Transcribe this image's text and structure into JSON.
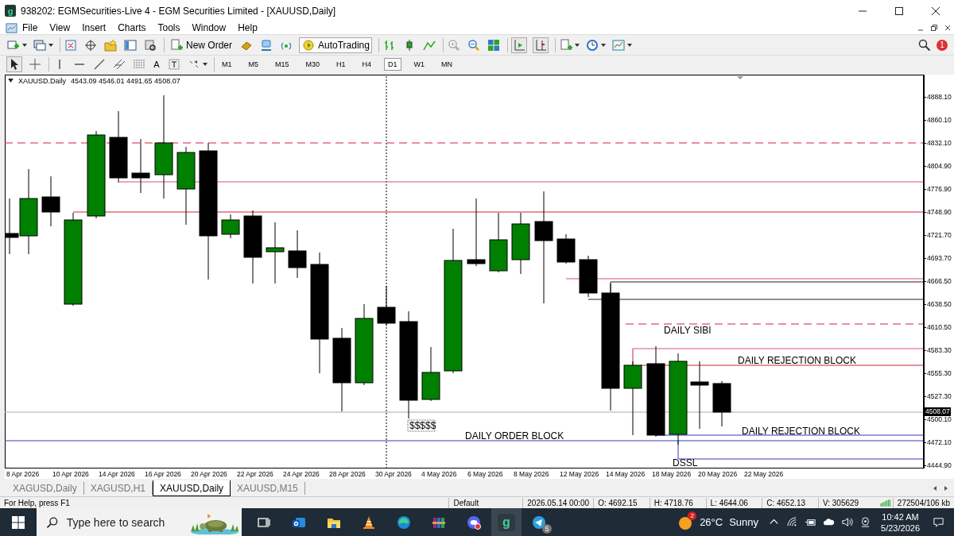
{
  "window": {
    "title": "938202: EGMSecurities-Live 4 - EGM Securities Limited - [XAUUSD,Daily]",
    "icon_letter": "g"
  },
  "menu": [
    "File",
    "View",
    "Insert",
    "Charts",
    "Tools",
    "Window",
    "Help"
  ],
  "toolbar": {
    "new_order": "New Order",
    "autotrading": "AutoTrading",
    "notification_count": "1"
  },
  "drawing_tools": {
    "text_tool": "A"
  },
  "timeframes": [
    {
      "label": "M1",
      "selected": false
    },
    {
      "label": "M5",
      "selected": false
    },
    {
      "label": "M15",
      "selected": false
    },
    {
      "label": "M30",
      "selected": false
    },
    {
      "label": "H1",
      "selected": false
    },
    {
      "label": "H4",
      "selected": false
    },
    {
      "label": "D1",
      "selected": true
    },
    {
      "label": "W1",
      "selected": false
    },
    {
      "label": "MN",
      "selected": false
    }
  ],
  "chart": {
    "symbol": "XAUUSD.Daily",
    "ohlc": "4543.09 4546.01 4491.65 4508.07",
    "price_axis": [
      "4888.10",
      "4860.10",
      "4832.10",
      "4804.90",
      "4776.90",
      "4748.90",
      "4721.70",
      "4693.70",
      "4666.50",
      "4638.50",
      "4610.50",
      "4583.30",
      "4555.30",
      "4527.30",
      "4500.10",
      "4472.10",
      "4444.90"
    ],
    "current_price": "4508.07",
    "date_axis": [
      "8 Apr 2026",
      "10 Apr 2026",
      "14 Apr 2026",
      "16 Apr 2026",
      "20 Apr 2026",
      "22 Apr 2026",
      "24 Apr 2026",
      "28 Apr 2026",
      "30 Apr 2026",
      "4 May 2026",
      "6 May 2026",
      "8 May 2026",
      "12 May 2026",
      "14 May 2026",
      "18 May 2026",
      "20 May 2026",
      "22 May 2026"
    ],
    "annotations": [
      {
        "text": "DAILY SIBI",
        "kind": "plain"
      },
      {
        "text": "DAILY REJECTION BLOCK",
        "kind": "plain"
      },
      {
        "text": "DAILY REJECTION BLOCK",
        "kind": "plain"
      },
      {
        "text": "DAILY ORDER BLOCK",
        "kind": "plain"
      },
      {
        "text": "$$$$$",
        "kind": "boxed"
      },
      {
        "text": "DSSL",
        "kind": "plain"
      }
    ]
  },
  "chart_tabs": [
    {
      "label": "XAGUSD,Daily",
      "selected": false
    },
    {
      "label": "XAGUSD,H1",
      "selected": false
    },
    {
      "label": "XAUUSD,Daily",
      "selected": true
    },
    {
      "label": "XAUUSD,M15",
      "selected": false
    }
  ],
  "status_bar": {
    "help": "For Help, press F1",
    "profile": "Default",
    "time": "2026.05.14 00:00",
    "open": "O: 4692.15",
    "high": "H: 4718.76",
    "low": "L: 4644.06",
    "close": "C: 4652.13",
    "volume": "V: 305629",
    "traffic": "272504/106 kb"
  },
  "taskbar": {
    "search_placeholder": "Type here to search",
    "app_letter": "g",
    "telegram_badge": "5",
    "weather_badge": "2",
    "temperature": "26°C",
    "condition": "Sunny",
    "time": "10:42 AM",
    "date": "5/23/2026"
  }
}
